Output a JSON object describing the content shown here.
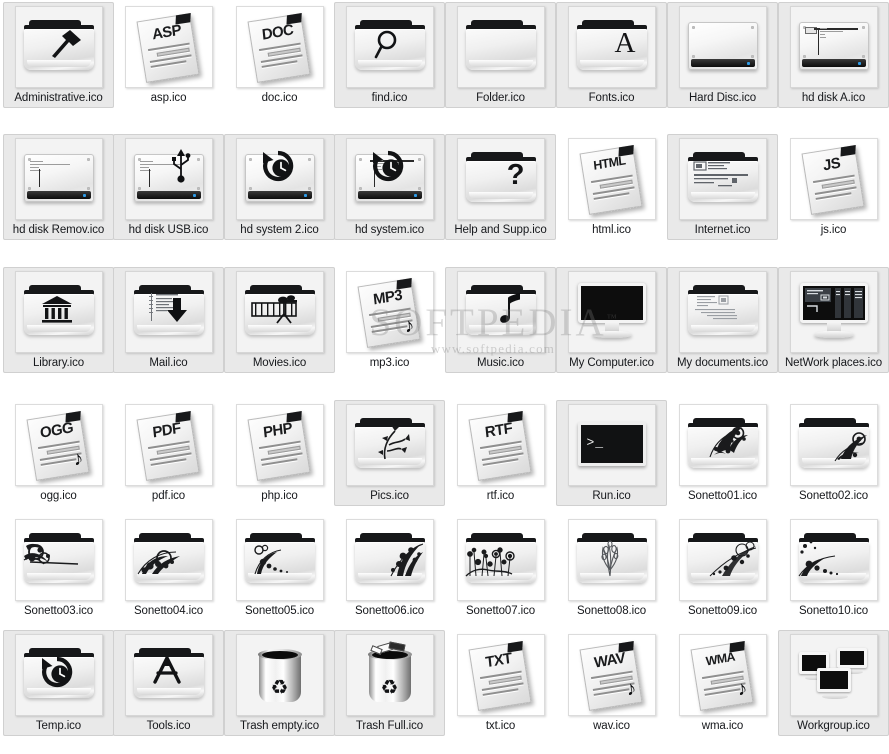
{
  "view": {
    "type": "icon-grid",
    "columns": 8,
    "rows": 6,
    "background_color": "#ffffff",
    "selection_color": "#e9e9e9",
    "label_color": "#16181c"
  },
  "watermark": {
    "main": "SOFTPEDIA",
    "trademark": "™",
    "sub": "www.softpedia.com"
  },
  "items": [
    {
      "label": "Administrative.ico",
      "icon": "folder-hammer-icon",
      "art": "folder",
      "glyph": "hammer",
      "selected": true
    },
    {
      "label": "asp.ico",
      "icon": "asp-document-icon",
      "art": "doc",
      "glyph": "ASP",
      "selected": false
    },
    {
      "label": "doc.ico",
      "icon": "doc-document-icon",
      "art": "doc",
      "glyph": "DOC",
      "selected": false
    },
    {
      "label": "find.ico",
      "icon": "folder-search-icon",
      "art": "folder",
      "glyph": "search",
      "selected": true
    },
    {
      "label": "Folder.ico",
      "icon": "folder-plain-icon",
      "art": "folder",
      "glyph": "none",
      "selected": true
    },
    {
      "label": "Fonts.ico",
      "icon": "folder-fonts-icon",
      "art": "folder",
      "glyph": "A",
      "selected": true
    },
    {
      "label": "Hard Disc.ico",
      "icon": "hard-disc-icon",
      "art": "hdd",
      "glyph": "none",
      "selected": true
    },
    {
      "label": "hd disk A.ico",
      "icon": "hard-disk-a-icon",
      "art": "hdd",
      "glyph": "chip",
      "selected": true
    },
    {
      "label": "hd disk Remov.ico",
      "icon": "hard-disk-removable-icon",
      "art": "hdd",
      "glyph": "label",
      "selected": true
    },
    {
      "label": "hd disk USB.ico",
      "icon": "hard-disk-usb-icon",
      "art": "hdd",
      "glyph": "usb",
      "selected": true
    },
    {
      "label": "hd system 2.ico",
      "icon": "hard-disk-system2-icon",
      "art": "hdd",
      "glyph": "history",
      "selected": true
    },
    {
      "label": "hd system.ico",
      "icon": "hard-disk-system-icon",
      "art": "hdd",
      "glyph": "history2",
      "selected": true
    },
    {
      "label": "Help and Supp.ico",
      "icon": "folder-help-icon",
      "art": "folder",
      "glyph": "question",
      "selected": true
    },
    {
      "label": "html.ico",
      "icon": "html-document-icon",
      "art": "doc",
      "glyph": "HTML",
      "selected": false
    },
    {
      "label": "Internet.ico",
      "icon": "folder-internet-icon",
      "art": "folder",
      "glyph": "webpage",
      "selected": true
    },
    {
      "label": "js.ico",
      "icon": "js-document-icon",
      "art": "doc",
      "glyph": "JS",
      "selected": false
    },
    {
      "label": "Library.ico",
      "icon": "folder-library-icon",
      "art": "folder",
      "glyph": "bank",
      "selected": true
    },
    {
      "label": "Mail.ico",
      "icon": "folder-mail-icon",
      "art": "folder",
      "glyph": "inbox",
      "selected": true
    },
    {
      "label": "Movies.ico",
      "icon": "folder-movies-icon",
      "art": "folder",
      "glyph": "camera",
      "selected": true
    },
    {
      "label": "mp3.ico",
      "icon": "mp3-document-icon",
      "art": "doc",
      "glyph": "MP3",
      "selected": false
    },
    {
      "label": "Music.ico",
      "icon": "folder-music-icon",
      "art": "folder",
      "glyph": "note",
      "selected": true
    },
    {
      "label": "My Computer.ico",
      "icon": "my-computer-icon",
      "art": "monitor",
      "glyph": "blank",
      "selected": true
    },
    {
      "label": "My documents.ico",
      "icon": "folder-documents-icon",
      "art": "folder",
      "glyph": "sheets",
      "selected": true
    },
    {
      "label": "NetWork places.ico",
      "icon": "network-places-icon",
      "art": "monitor",
      "glyph": "network",
      "selected": true
    },
    {
      "label": "ogg.ico",
      "icon": "ogg-document-icon",
      "art": "doc",
      "glyph": "OGG",
      "selected": false
    },
    {
      "label": "pdf.ico",
      "icon": "pdf-document-icon",
      "art": "doc",
      "glyph": "PDF",
      "selected": false
    },
    {
      "label": "php.ico",
      "icon": "php-document-icon",
      "art": "doc",
      "glyph": "PHP",
      "selected": false
    },
    {
      "label": "Pics.ico",
      "icon": "folder-pics-icon",
      "art": "folder",
      "glyph": "vine",
      "selected": true
    },
    {
      "label": "rtf.ico",
      "icon": "rtf-document-icon",
      "art": "doc",
      "glyph": "RTF",
      "selected": false
    },
    {
      "label": "Run.ico",
      "icon": "run-terminal-icon",
      "art": "terminal",
      "glyph": ">_",
      "selected": true
    },
    {
      "label": "Sonetto01.ico",
      "icon": "folder-sonetto01-icon",
      "art": "folder",
      "glyph": "orn1",
      "selected": false
    },
    {
      "label": "Sonetto02.ico",
      "icon": "folder-sonetto02-icon",
      "art": "folder",
      "glyph": "orn2",
      "selected": false
    },
    {
      "label": "Sonetto03.ico",
      "icon": "folder-sonetto03-icon",
      "art": "folder",
      "glyph": "orn3",
      "selected": false
    },
    {
      "label": "Sonetto04.ico",
      "icon": "folder-sonetto04-icon",
      "art": "folder",
      "glyph": "orn4",
      "selected": false
    },
    {
      "label": "Sonetto05.ico",
      "icon": "folder-sonetto05-icon",
      "art": "folder",
      "glyph": "orn5",
      "selected": false
    },
    {
      "label": "Sonetto06.ico",
      "icon": "folder-sonetto06-icon",
      "art": "folder",
      "glyph": "orn6",
      "selected": false
    },
    {
      "label": "Sonetto07.ico",
      "icon": "folder-sonetto07-icon",
      "art": "folder",
      "glyph": "orn7",
      "selected": false
    },
    {
      "label": "Sonetto08.ico",
      "icon": "folder-sonetto08-icon",
      "art": "folder",
      "glyph": "orn8",
      "selected": false
    },
    {
      "label": "Sonetto09.ico",
      "icon": "folder-sonetto09-icon",
      "art": "folder",
      "glyph": "orn9",
      "selected": false
    },
    {
      "label": "Sonetto10.ico",
      "icon": "folder-sonetto10-icon",
      "art": "folder",
      "glyph": "orn10",
      "selected": false
    },
    {
      "label": "Temp.ico",
      "icon": "folder-temp-icon",
      "art": "folder",
      "glyph": "history",
      "selected": true
    },
    {
      "label": "Tools.ico",
      "icon": "folder-tools-icon",
      "art": "folder",
      "glyph": "appstore",
      "selected": true
    },
    {
      "label": "Trash empty.ico",
      "icon": "trash-empty-icon",
      "art": "trash",
      "glyph": "empty",
      "selected": true
    },
    {
      "label": "Trash Full.ico",
      "icon": "trash-full-icon",
      "art": "trash",
      "glyph": "full",
      "selected": true
    },
    {
      "label": "txt.ico",
      "icon": "txt-document-icon",
      "art": "doc",
      "glyph": "TXT",
      "selected": false
    },
    {
      "label": "wav.ico",
      "icon": "wav-document-icon",
      "art": "doc",
      "glyph": "WAV",
      "selected": false
    },
    {
      "label": "wma.ico",
      "icon": "wma-document-icon",
      "art": "doc",
      "glyph": "WMA",
      "selected": false
    },
    {
      "label": "Workgroup.ico",
      "icon": "workgroup-icon",
      "art": "workgroup",
      "glyph": "three",
      "selected": true
    }
  ]
}
